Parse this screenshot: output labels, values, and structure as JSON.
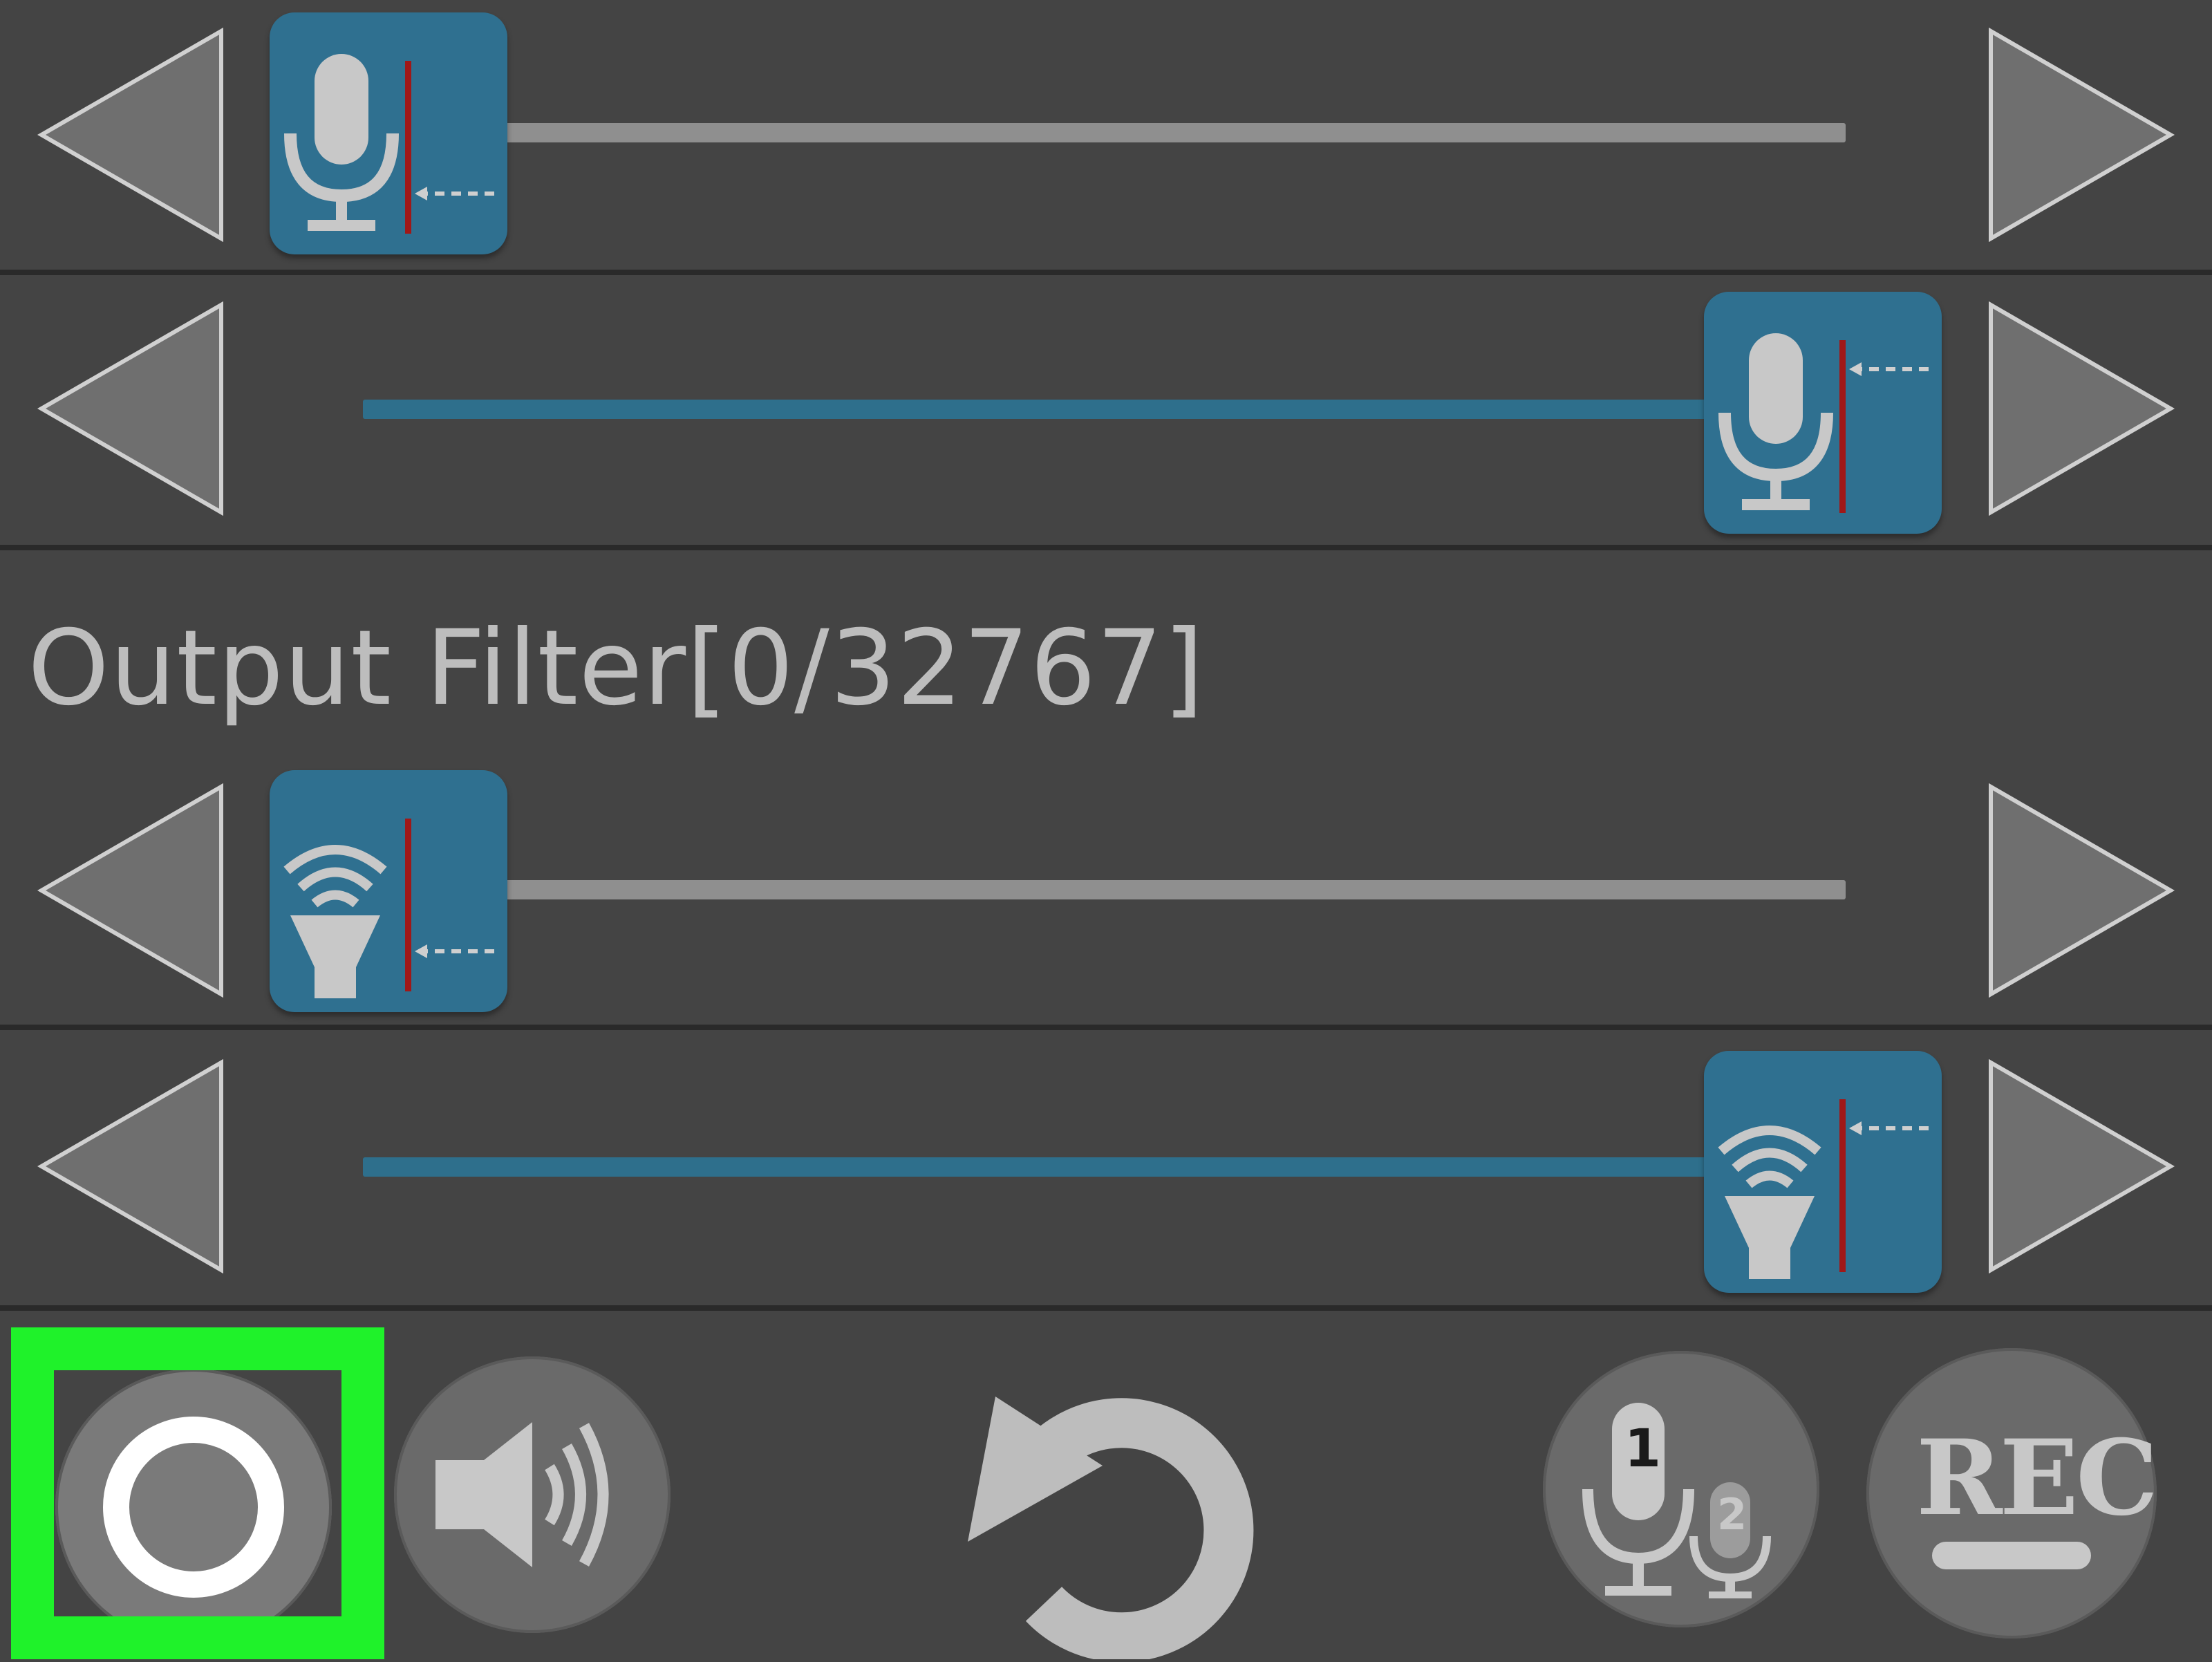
{
  "output_filter": {
    "label": "Output Filter[0/32767]"
  },
  "sliders": [
    {
      "name": "mic-gain-slider",
      "thumb_icon": "microphone-icon",
      "level": 0.0
    },
    {
      "name": "mic-max-slider",
      "thumb_icon": "microphone-icon",
      "level": 1.0
    },
    {
      "name": "output-filter-min-slider",
      "thumb_icon": "speaker-icon",
      "level": 0.0
    },
    {
      "name": "output-filter-max-slider",
      "thumb_icon": "speaker-icon",
      "level": 1.0
    }
  ],
  "toolbar": {
    "record_toggle_icon": "circle-icon",
    "volume_icon": "speaker-volume-icon",
    "reset_icon": "refresh-icon",
    "mic_select_icon": "dual-microphone-icon",
    "mic_select_primary": "1",
    "mic_select_secondary": "2",
    "rec_label": "REC"
  },
  "colors": {
    "background": "#444444",
    "thumb": "#2f7090",
    "track_active": "#2e6f8c",
    "track_inactive": "#8f8f8f",
    "highlight": "#1ff22a"
  }
}
